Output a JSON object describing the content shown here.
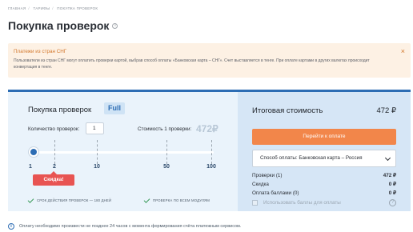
{
  "breadcrumb": {
    "items": [
      "ГЛАВНАЯ",
      "ТАРИФЫ",
      "ПОКУПКА ПРОВЕРОК"
    ],
    "sep": "/"
  },
  "title": "Покупка проверок",
  "notice": {
    "title": "Платежи из стран СНГ",
    "text": "Пользователи из стран СНГ могут оплатить проверки картой, выбрав способ оплаты «Банковская карта – СНГ». Счет выставляется в тенге. При оплате картами в других валютах происходит конвертация в тенге.",
    "close": "×"
  },
  "calc": {
    "title": "Покупка проверок",
    "badge": "Full",
    "qty_label": "Количество проверок:",
    "qty_value": "1",
    "cost_label": "Стоимость 1 проверки:",
    "cost_value": "472₽",
    "slider": {
      "ticks": [
        "1",
        "2",
        "10",
        "50",
        "100"
      ],
      "value": 1
    },
    "discount": "Скидка!",
    "feature1": "СРОК ДЕЙСТВИЯ ПРОВЕРОК — 180 ДНЕЙ",
    "feature2": "ПРОВЕРКА ПО ВСЕМ МОДУЛЯМ"
  },
  "summary": {
    "title": "Итоговая стоимость",
    "total": "472 ₽",
    "pay_button": "Перейти к оплате",
    "payment_method": "Способ оплаты: Банковская карта – Россия",
    "rows": [
      {
        "label": "Проверки (1)",
        "value": "472 ₽"
      },
      {
        "label": "Скидка",
        "value": "0 ₽"
      },
      {
        "label": "Оплата баллами (0)",
        "value": "0 ₽"
      }
    ],
    "use_points": "Использовать баллы для оплаты",
    "help": "?"
  },
  "footer": {
    "text": "Оплату необходимо произвести не позднее 24 часов с момента формирования счёта платежным сервисом."
  },
  "colors": {
    "accent": "#2d6db4",
    "pay_button": "#f2864a",
    "discount": "#e85452",
    "notice_bg": "#fdf1e4"
  }
}
